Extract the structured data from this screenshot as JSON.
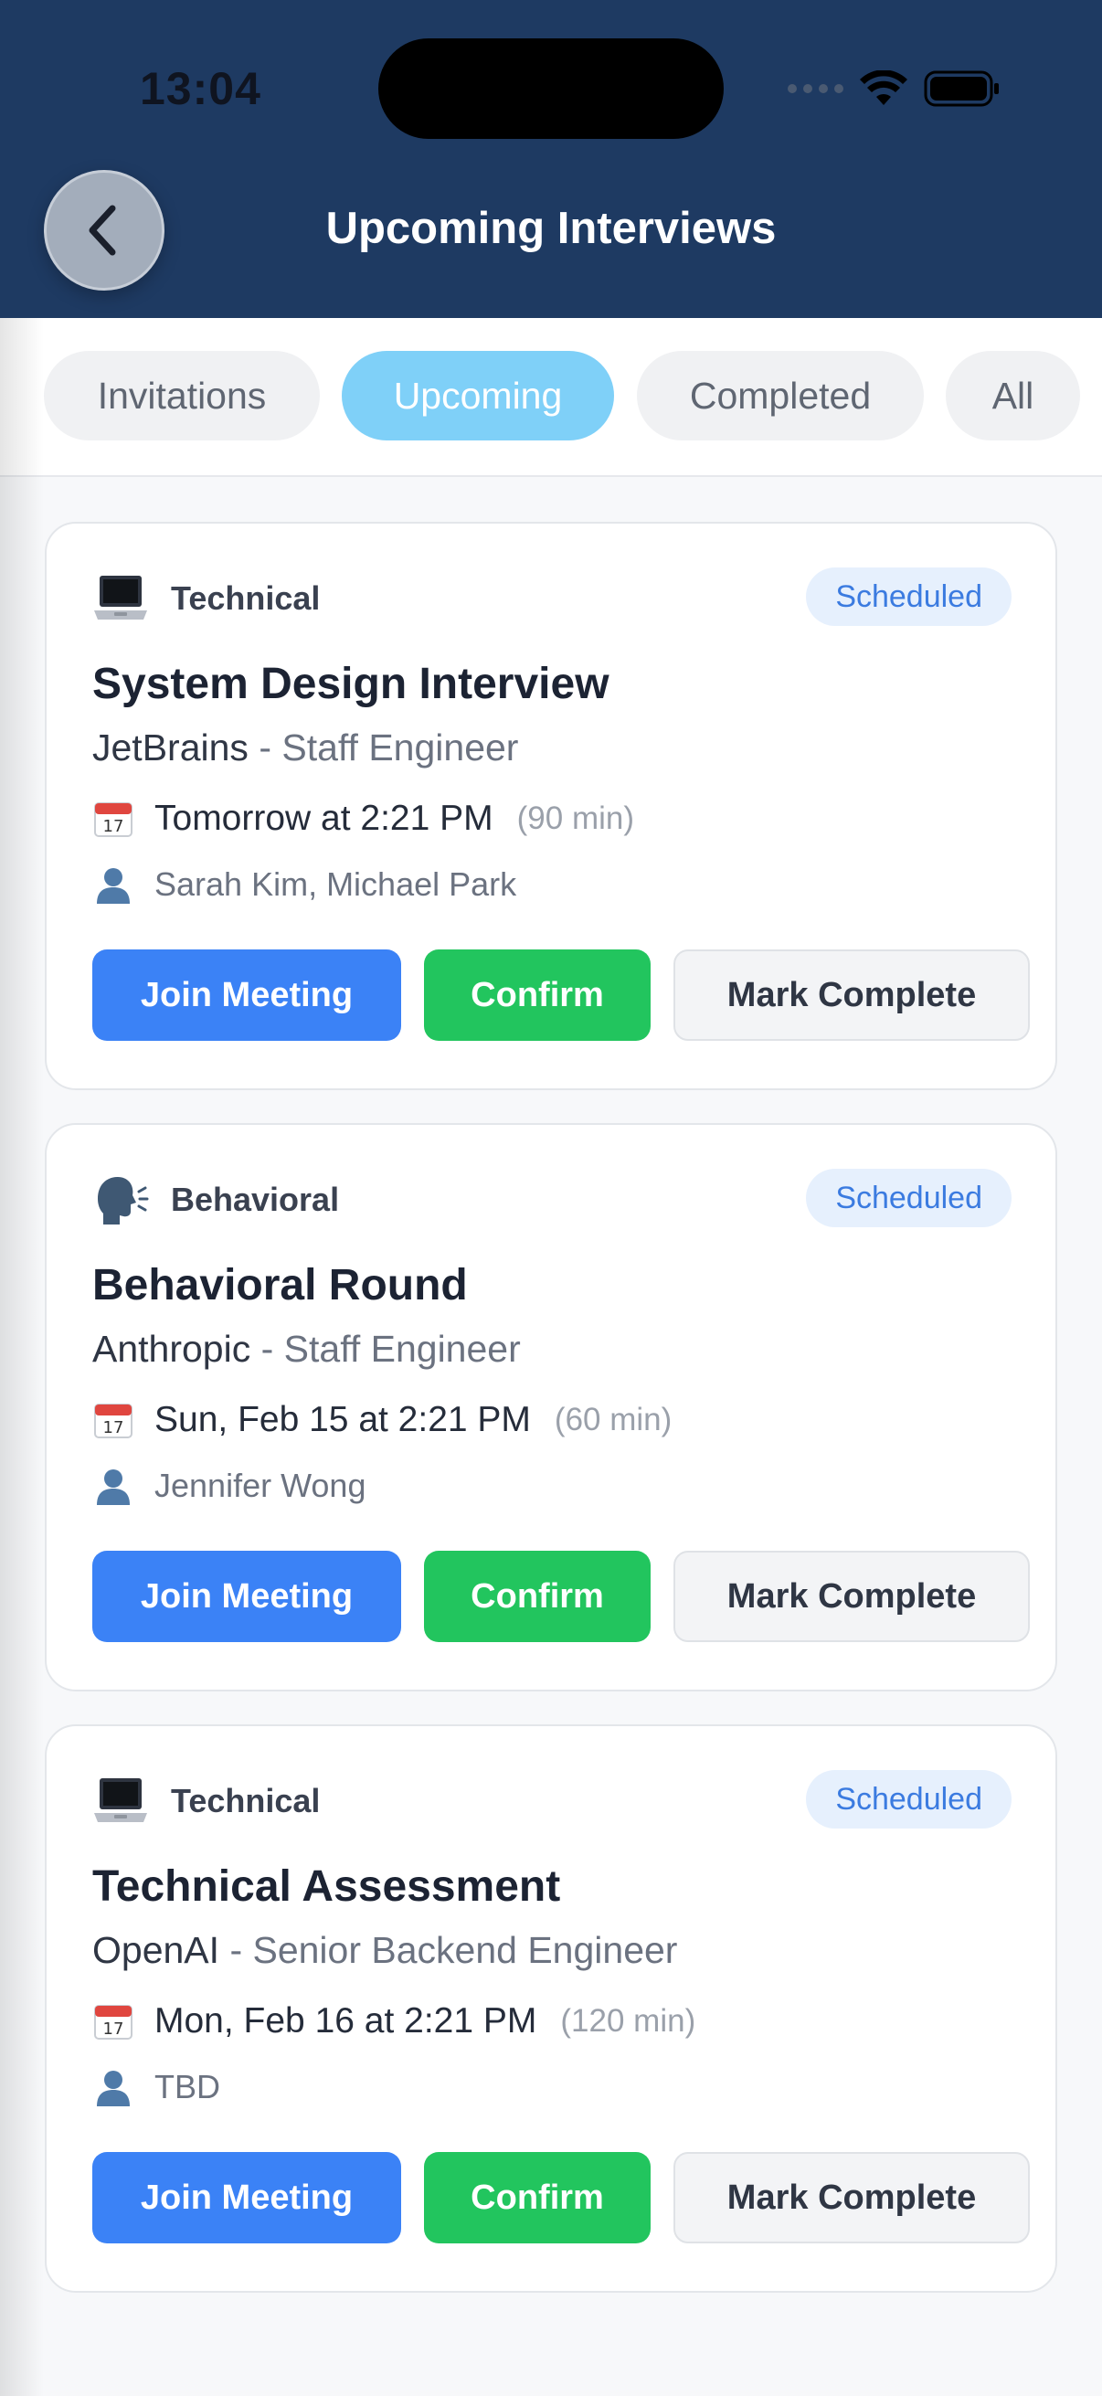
{
  "status_bar": {
    "time": "13:04"
  },
  "header": {
    "title": "Upcoming Interviews"
  },
  "tabs": [
    {
      "label": "Invitations",
      "active": false
    },
    {
      "label": "Upcoming",
      "active": true
    },
    {
      "label": "Completed",
      "active": false
    },
    {
      "label": "All",
      "active": false
    }
  ],
  "interviews": [
    {
      "type": "Technical",
      "type_icon": "laptop-icon",
      "status": "Scheduled",
      "title": "System Design Interview",
      "company": "JetBrains",
      "role": " - Staff Engineer",
      "date": "Tomorrow at 2:21 PM",
      "duration": "(90 min)",
      "interviewers": "Sarah Kim, Michael Park",
      "buttons": {
        "join": "Join Meeting",
        "confirm": "Confirm",
        "complete": "Mark Complete"
      }
    },
    {
      "type": "Behavioral",
      "type_icon": "speaking-head-icon",
      "status": "Scheduled",
      "title": "Behavioral Round",
      "company": "Anthropic",
      "role": " - Staff Engineer",
      "date": "Sun, Feb 15 at 2:21 PM",
      "duration": "(60 min)",
      "interviewers": "Jennifer Wong",
      "buttons": {
        "join": "Join Meeting",
        "confirm": "Confirm",
        "complete": "Mark Complete"
      }
    },
    {
      "type": "Technical",
      "type_icon": "laptop-icon",
      "status": "Scheduled",
      "title": "Technical Assessment",
      "company": "OpenAI",
      "role": " - Senior Backend Engineer",
      "date": "Mon, Feb 16 at 2:21 PM",
      "duration": "(120 min)",
      "interviewers": "TBD",
      "buttons": {
        "join": "Join Meeting",
        "confirm": "Confirm",
        "complete": "Mark Complete"
      }
    }
  ],
  "colors": {
    "header_bg": "#1e3a62",
    "tab_active": "#7fd0f8",
    "badge_bg": "#e6f0fd",
    "badge_text": "#3b7be0",
    "join": "#3b82f6",
    "confirm": "#22c55e"
  }
}
